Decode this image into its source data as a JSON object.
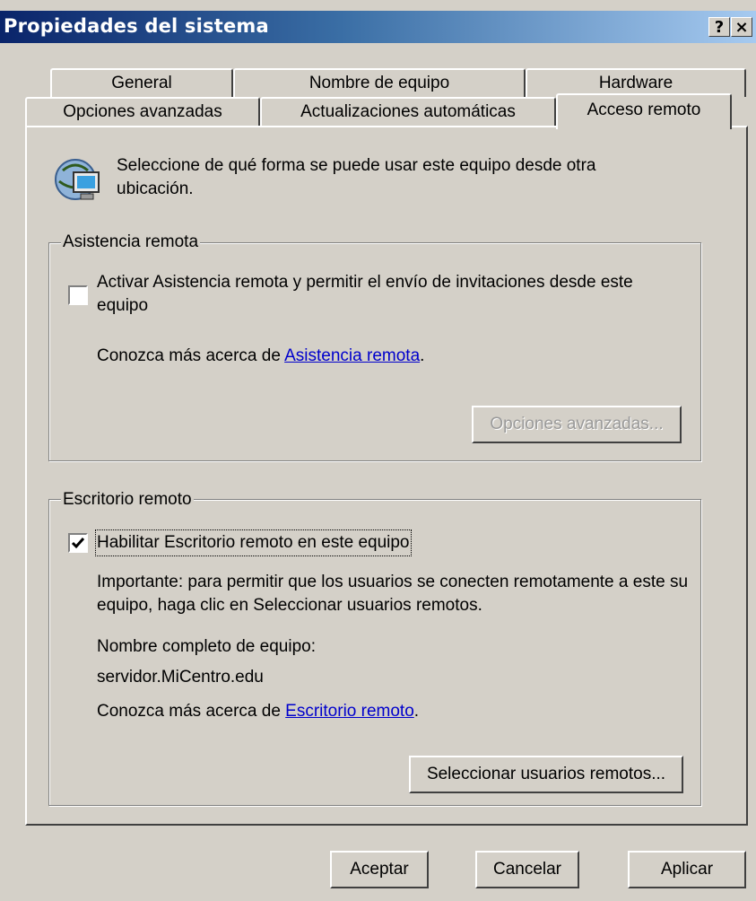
{
  "window": {
    "title": "Propiedades del sistema",
    "help_label": "?",
    "close_label": "×"
  },
  "tabs": {
    "row1": [
      "General",
      "Nombre de equipo",
      "Hardware"
    ],
    "row2": [
      "Opciones avanzadas",
      "Actualizaciones automáticas",
      "Acceso remoto"
    ],
    "active": "Acceso remoto"
  },
  "intro_text": "Seleccione de qué forma se puede usar este equipo desde otra ubicación.",
  "remote_assistance": {
    "legend": "Asistencia remota",
    "checkbox_label": "Activar Asistencia remota y permitir el envío de invitaciones desde este equipo",
    "checked": false,
    "learn_prefix": "Conozca más acerca de ",
    "learn_link": "Asistencia remota",
    "learn_suffix": ".",
    "advanced_button": "Opciones avanzadas..."
  },
  "remote_desktop": {
    "legend": "Escritorio remoto",
    "checkbox_label": "Habilitar Escritorio remoto en este equipo",
    "checked": true,
    "important_text": "Importante: para permitir que los usuarios se conecten remotamente a este su equipo, haga clic en Seleccionar usuarios remotos.",
    "full_name_label": "Nombre completo de equipo:",
    "full_name_value": "servidor.MiCentro.edu",
    "learn_prefix": "Conozca más acerca de ",
    "learn_link": "Escritorio remoto",
    "learn_suffix": ".",
    "select_users_button": "Seleccionar usuarios remotos..."
  },
  "footer": {
    "ok_button": "Aceptar",
    "cancel_button": "Cancelar",
    "apply_button": "Aplicar"
  },
  "colors": {
    "titlebar_start": "#0a246a",
    "titlebar_end": "#a6caf0",
    "face": "#d4d0c8",
    "link": "#0000cc"
  }
}
